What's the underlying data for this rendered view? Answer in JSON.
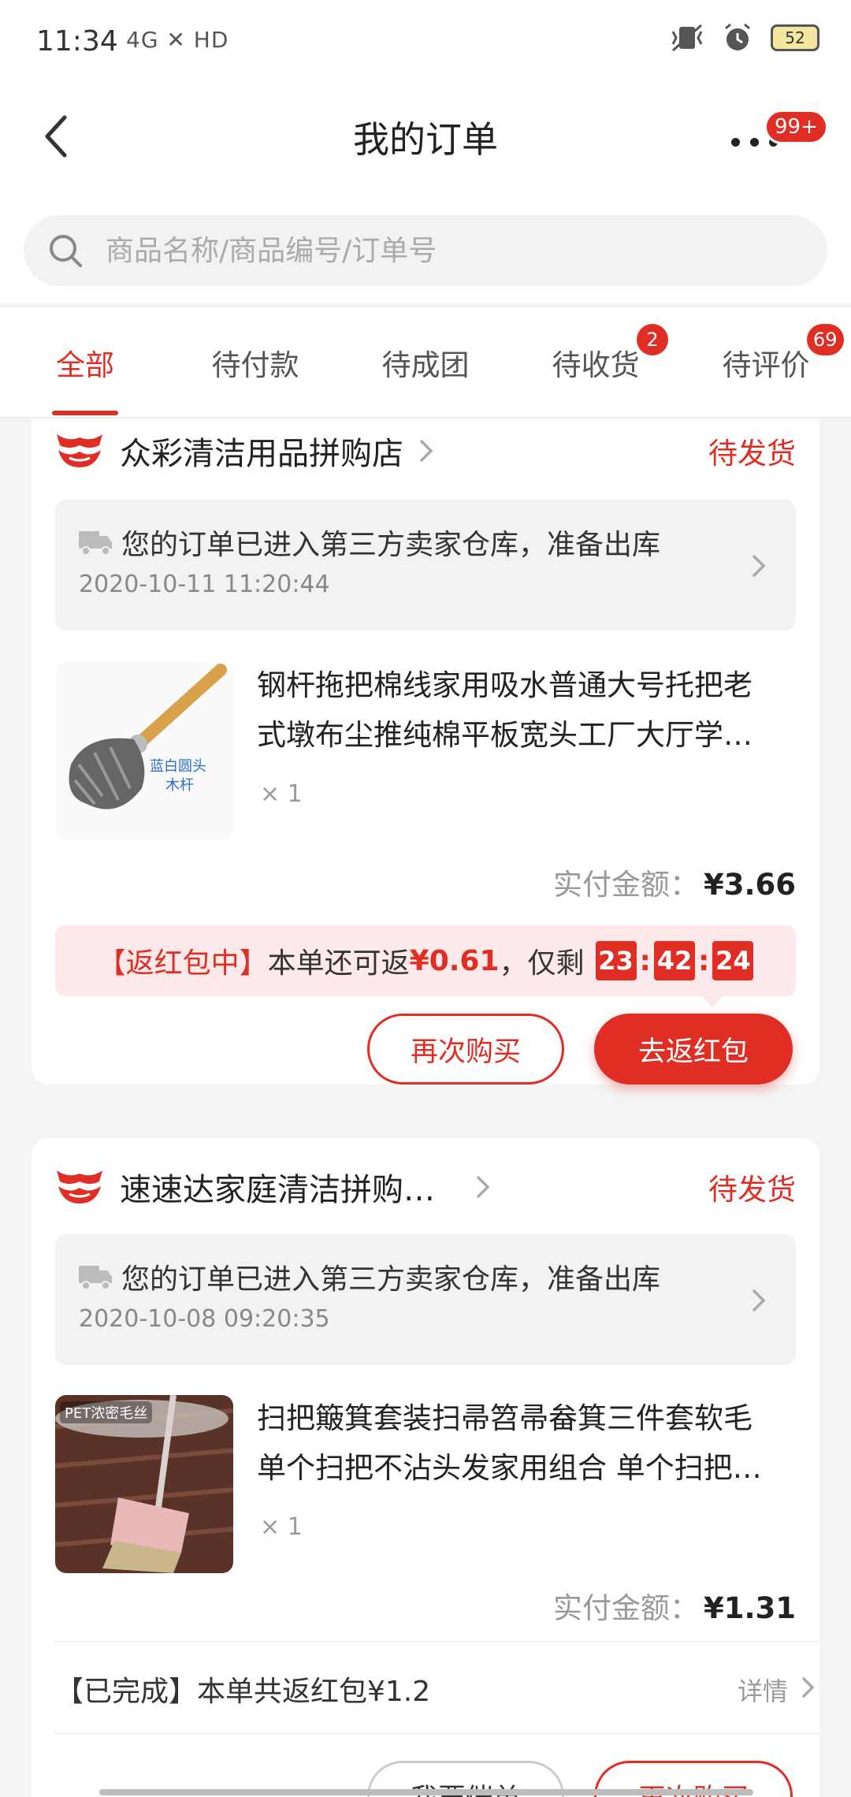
{
  "status_bar": {
    "time": "11:34",
    "network": "4G  ✕  HD",
    "battery": "52"
  },
  "nav": {
    "title": "我的订单",
    "message_badge": "99+"
  },
  "search": {
    "placeholder": "商品名称/商品编号/订单号"
  },
  "tabs": [
    {
      "label": "全部",
      "active": true
    },
    {
      "label": "待付款"
    },
    {
      "label": "待成团"
    },
    {
      "label": "待收货",
      "badge": "2"
    },
    {
      "label": "待评价",
      "badge": "69"
    }
  ],
  "orders": [
    {
      "shop_name": "众彩清洁用品拼购店",
      "status": "待发货",
      "logistics": {
        "message": "您的订单已进入第三方卖家仓库，准备出库",
        "time": "2020-10-11 11:20:44"
      },
      "product": {
        "title_line1": "钢杆拖把棉线家用吸水普通大号托把老",
        "title_line2": "式墩布尘推纯棉平板宽头工厂大厅学…",
        "thumb_label_1": "蓝白圆头",
        "thumb_label_2": "木杆",
        "quantity": "× 1"
      },
      "payment": {
        "label": "实付金额：",
        "amount": "¥3.66"
      },
      "promo": {
        "prefix": "【返红包中】",
        "text_before": "本单还可返",
        "amount": "¥0.61",
        "text_after": "，仅剩",
        "countdown": [
          "23",
          "42",
          "24"
        ]
      },
      "buttons": {
        "rebuy": "再次购买",
        "redpacket": "去返红包"
      }
    },
    {
      "shop_name": "速速达家庭清洁拼购…",
      "status": "待发货",
      "logistics": {
        "message": "您的订单已进入第三方卖家仓库，准备出库",
        "time": "2020-10-08 09:20:35"
      },
      "product": {
        "title_line1": "扫把簸箕套装扫帚笤帚畚箕三件套软毛",
        "title_line2": "单个扫把不沾头发家用组合 单个扫把…",
        "thumb_label": "PET浓密毛丝",
        "quantity": "× 1"
      },
      "payment": {
        "label": "实付金额：",
        "amount": "¥1.31"
      },
      "completed": {
        "text": "【已完成】本单共返红包¥1.2",
        "detail": "详情"
      },
      "buttons": {
        "urge": "我要催单",
        "rebuy": "再次购买"
      }
    }
  ],
  "colors": {
    "accent": "#e02e24",
    "background": "#f4f4f4",
    "promo_bg": "#fde9e9"
  }
}
